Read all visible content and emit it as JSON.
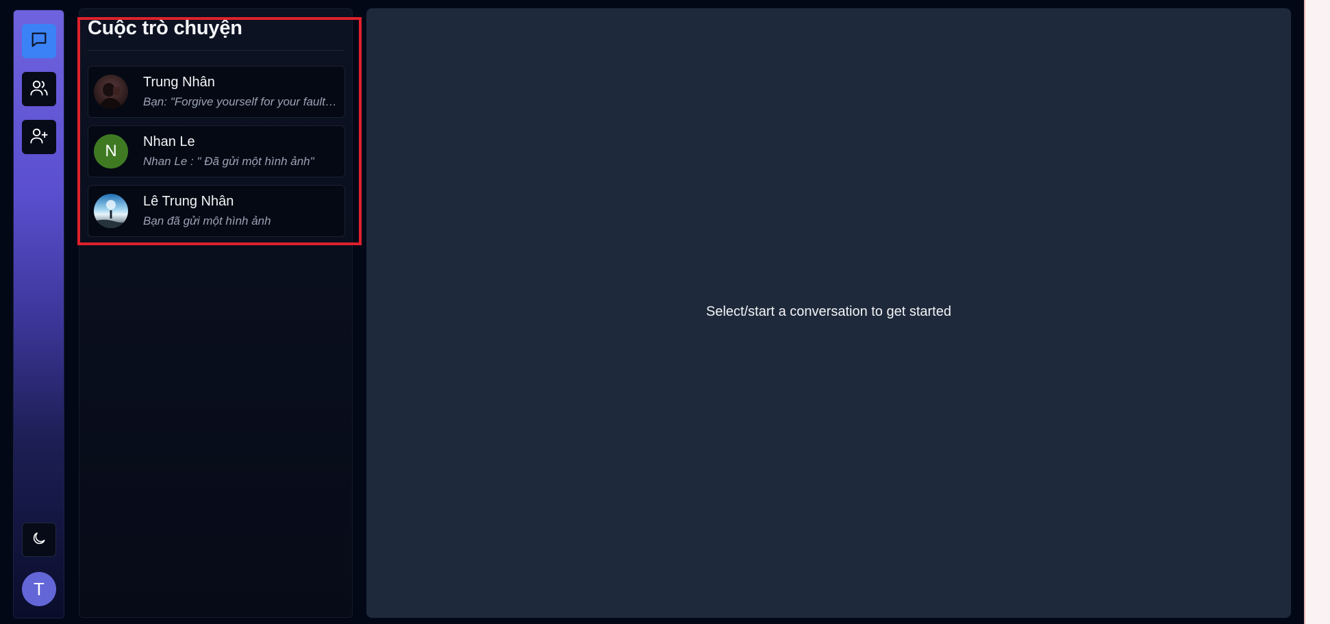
{
  "sidebar": {
    "items": [
      {
        "icon": "chat-bubble-icon",
        "active": true
      },
      {
        "icon": "users-icon",
        "active": false
      },
      {
        "icon": "user-plus-icon",
        "active": false
      }
    ],
    "theme_icon": "moon-icon",
    "user_initial": "T",
    "colors": {
      "active": "#3b82f6",
      "avatar": "#6366d6"
    }
  },
  "conversations": {
    "title": "Cuộc trò chuyện",
    "items": [
      {
        "name": "Trung Nhân",
        "preview": "Bạn: \"Forgive yourself for your faults and your mistakes and move on.\"",
        "avatar_type": "photo-dark"
      },
      {
        "name": "Nhan Le",
        "preview": "Nhan Le : \" Đã gửi một hình ảnh\"",
        "avatar_type": "initial",
        "avatar_initial": "N",
        "avatar_color": "#3f7a23"
      },
      {
        "name": "Lê Trung Nhân",
        "preview": "Bạn đã gửi một hình ảnh",
        "avatar_type": "photo-sky"
      }
    ]
  },
  "main": {
    "empty_message": "Select/start a conversation to get started"
  }
}
